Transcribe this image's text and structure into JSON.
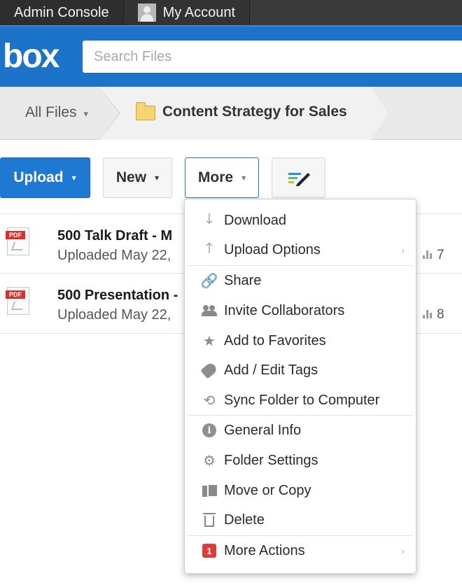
{
  "topbar": {
    "admin_console": "Admin Console",
    "my_account": "My Account"
  },
  "header": {
    "logo": "box",
    "search_placeholder": "Search Files"
  },
  "breadcrumb": {
    "all_files": "All Files",
    "current_folder": "Content Strategy for Sales"
  },
  "toolbar": {
    "upload": "Upload",
    "new": "New",
    "more": "More",
    "notes_icon": "notes-pencil-icon"
  },
  "files": [
    {
      "name": "500 Talk Draft - M",
      "meta": "Uploaded May 22,",
      "count": "7",
      "type": "PDF"
    },
    {
      "name": "500 Presentation -",
      "meta": "Uploaded May 22,",
      "count": "8",
      "type": "PDF"
    }
  ],
  "menu": {
    "items": [
      {
        "label": "Download",
        "icon": "download-arrow-icon"
      },
      {
        "label": "Upload Options",
        "icon": "upload-arrow-icon",
        "submenu": true
      },
      {
        "label": "Share",
        "icon": "link-icon"
      },
      {
        "label": "Invite Collaborators",
        "icon": "collaborators-icon"
      },
      {
        "label": "Add to Favorites",
        "icon": "star-icon"
      },
      {
        "label": "Add / Edit Tags",
        "icon": "tag-icon"
      },
      {
        "label": "Sync Folder to Computer",
        "icon": "sync-icon"
      },
      {
        "label": "General Info",
        "icon": "info-icon"
      },
      {
        "label": "Folder Settings",
        "icon": "gear-icon"
      },
      {
        "label": "Move or Copy",
        "icon": "copy-icon"
      },
      {
        "label": "Delete",
        "icon": "trash-icon"
      },
      {
        "label": "More Actions",
        "icon": "notification-badge",
        "badge": "1",
        "submenu": true
      }
    ]
  },
  "colors": {
    "header_blue": "#1d73c9",
    "upload_blue": "#1f78d1",
    "badge_red": "#de3b3b",
    "pdf_red": "#d6332b"
  }
}
